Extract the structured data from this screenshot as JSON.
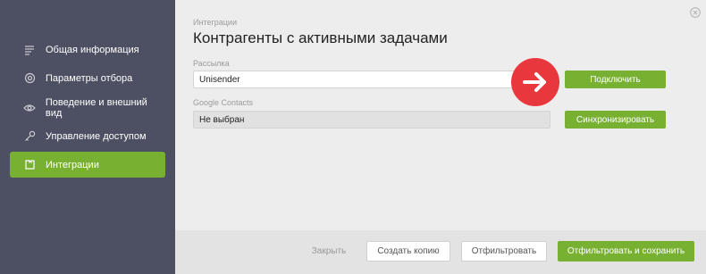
{
  "sidebar": {
    "items": [
      {
        "label": "Общая информация",
        "icon": "list-icon",
        "active": false
      },
      {
        "label": "Параметры отбора",
        "icon": "gear-icon",
        "active": false
      },
      {
        "label": "Поведение и внешний вид",
        "icon": "eye-icon",
        "active": false
      },
      {
        "label": "Управление доступом",
        "icon": "key-icon",
        "active": false
      },
      {
        "label": "Интеграции",
        "icon": "puzzle-icon",
        "active": true
      }
    ]
  },
  "main": {
    "breadcrumb": "Интеграции",
    "title": "Контрагенты с активными задачами",
    "mailing": {
      "label": "Рассылка",
      "value": "Unisender",
      "button": "Подключить"
    },
    "google": {
      "label": "Google Contacts",
      "value": "Не выбран",
      "button": "Синхронизировать"
    }
  },
  "footer": {
    "close_label": "Закрыть",
    "copy_label": "Создать копию",
    "filter_label": "Отфильтровать",
    "filter_save_label": "Отфильтровать и сохранить"
  },
  "colors": {
    "sidebar_bg": "#4d5062",
    "accent_green": "#78b032",
    "arrow_red": "#e8383d",
    "main_bg": "#ededed"
  }
}
